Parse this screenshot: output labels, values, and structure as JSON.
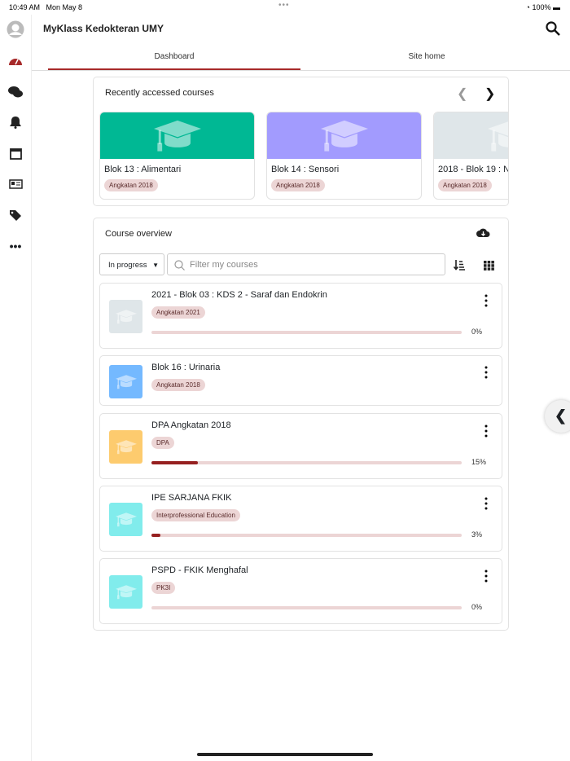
{
  "status": {
    "time": "10:49 AM",
    "date": "Mon May 8",
    "battery": "100%"
  },
  "header": {
    "title": "MyKlass Kedokteran UMY"
  },
  "tabs": [
    {
      "label": "Dashboard"
    },
    {
      "label": "Site home"
    }
  ],
  "recent": {
    "title": "Recently accessed courses",
    "courses": [
      {
        "name": "Blok 13 : Alimentari",
        "badge": "Angkatan 2018",
        "color": "#00b894"
      },
      {
        "name": "Blok 14 : Sensori",
        "badge": "Angkatan 2018",
        "color": "#a29bfe"
      },
      {
        "name": "2018 - Blok 19 : N",
        "badge": "Angkatan 2018",
        "color": "#dfe6e9"
      }
    ]
  },
  "overview": {
    "title": "Course overview",
    "filter_select": "In progress",
    "filter_placeholder": "Filter my courses",
    "courses": [
      {
        "name": "2021 - Blok 03 : KDS 2 - Saraf dan Endokrin",
        "badge": "Angkatan 2021",
        "progress": 0,
        "progress_label": "0%",
        "color": "#dfe6e9"
      },
      {
        "name": "Blok 16 : Urinaria",
        "badge": "Angkatan 2018",
        "color": "#74b9ff"
      },
      {
        "name": "DPA Angkatan 2018",
        "badge": "DPA",
        "progress": 15,
        "progress_label": "15%",
        "color": "#fdcb6e"
      },
      {
        "name": "IPE SARJANA FKIK",
        "badge": "Interprofessional Education",
        "progress": 3,
        "progress_label": "3%",
        "color": "#81ecec"
      },
      {
        "name": "PSPD - FKIK Menghafal",
        "badge": "PK3I",
        "progress": 0,
        "progress_label": "0%",
        "color": "#81ecec"
      }
    ]
  }
}
